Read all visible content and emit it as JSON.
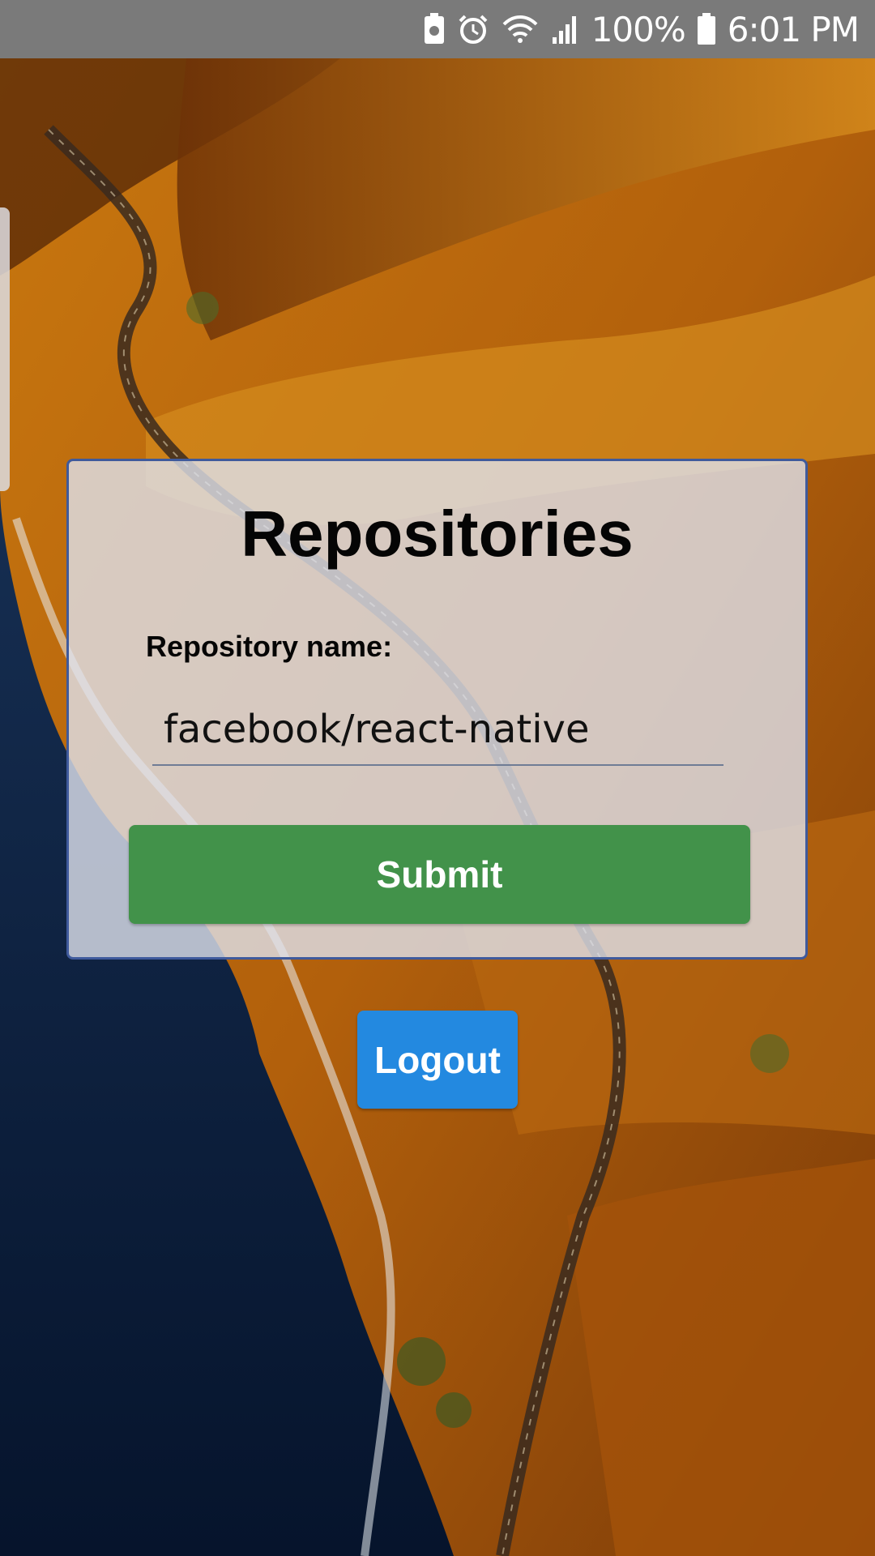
{
  "status_bar": {
    "icons": [
      "recycle-battery-icon",
      "alarm-icon",
      "wifi-icon",
      "signal-icon",
      "battery-icon"
    ],
    "battery_text": "100%",
    "time": "6:01 PM"
  },
  "repositories": {
    "title": "Repositories",
    "field_label": "Repository name:",
    "input_value": "facebook/react-native",
    "submit_label": "Submit"
  },
  "logout_label": "Logout",
  "colors": {
    "status_bar": "#7a7a7a",
    "card_border": "#3f5a9c",
    "submit": "#42924a",
    "logout": "#2389e0"
  }
}
